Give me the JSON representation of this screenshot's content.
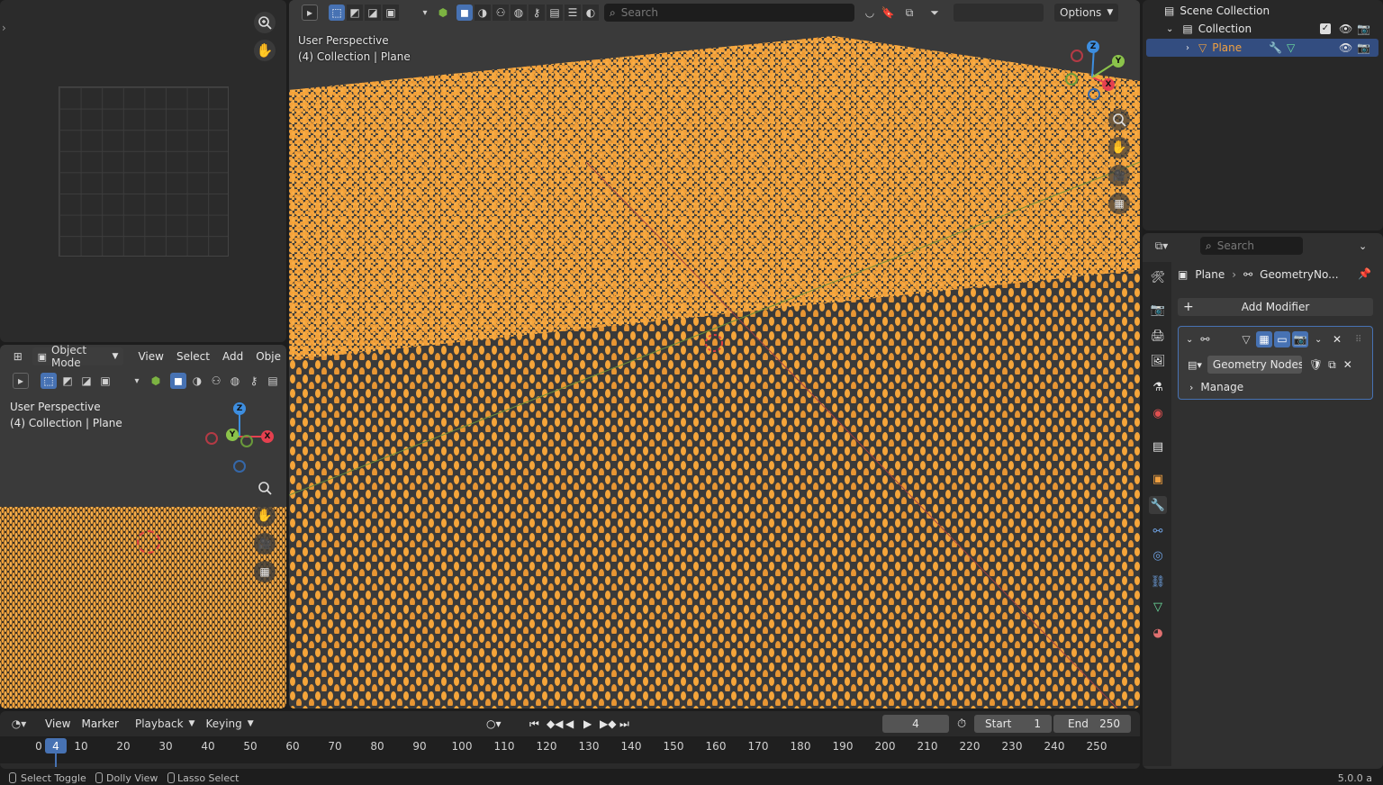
{
  "image_editor": {
    "zoom_icon": "zoom-in-icon",
    "hand_icon": "hand-pan-icon"
  },
  "viewport_small": {
    "mode": "Object Mode",
    "menus": [
      "View",
      "Select",
      "Add",
      "Obje"
    ],
    "perspective": "User Perspective",
    "collection_info": "(4) Collection | Plane",
    "gizmo": {
      "z": "Z",
      "y": "Y",
      "x": "X"
    }
  },
  "viewport_main": {
    "search_placeholder": "Search",
    "options_label": "Options",
    "perspective": "User Perspective",
    "collection_info": "(4) Collection | Plane",
    "gizmo": {
      "z": "Z",
      "y": "Y",
      "x": "X"
    }
  },
  "outliner": {
    "scene_collection": "Scene Collection",
    "collection": "Collection",
    "plane": "Plane"
  },
  "properties": {
    "search_placeholder": "Search",
    "breadcrumb_object": "Plane",
    "breadcrumb_modifier": "GeometryNo...",
    "add_modifier": "Add Modifier",
    "node_group_name": "Geometry Nodes...",
    "manage": "Manage",
    "tabs": [
      "tool",
      "render",
      "output",
      "view-layer",
      "scene",
      "world",
      "collection",
      "object",
      "modifiers",
      "particles",
      "physics",
      "constraints",
      "data",
      "material"
    ]
  },
  "timeline": {
    "menus": [
      "View",
      "Marker"
    ],
    "playback": "Playback",
    "keying": "Keying",
    "current_frame": "4",
    "start_label": "Start",
    "start_value": "1",
    "end_label": "End",
    "end_value": "250",
    "ticks": [
      "0",
      "10",
      "20",
      "30",
      "40",
      "50",
      "60",
      "70",
      "80",
      "90",
      "100",
      "110",
      "120",
      "130",
      "140",
      "150",
      "160",
      "170",
      "180",
      "190",
      "200",
      "210",
      "220",
      "230",
      "240",
      "250"
    ],
    "current_tick": "4"
  },
  "status_bar": {
    "select_toggle": "Select Toggle",
    "dolly_view": "Dolly View",
    "lasso_select": "Lasso Select",
    "version": "5.0.0 a"
  },
  "colors": {
    "accent": "#4772b3",
    "instances": "#f5a53a",
    "axis_x": "#e5404f",
    "axis_y": "#8bc34a",
    "axis_z": "#3d8ee0"
  }
}
